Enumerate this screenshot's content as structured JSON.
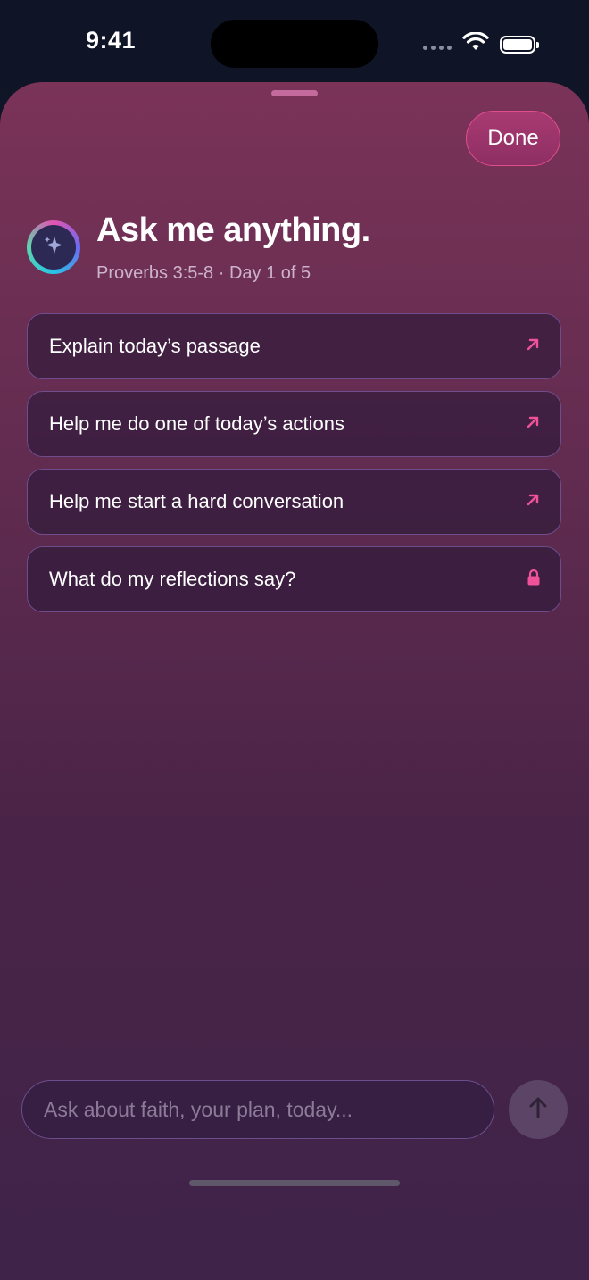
{
  "status_bar": {
    "time": "9:41"
  },
  "sheet": {
    "done_label": "Done",
    "title": "Ask me anything.",
    "subtitle": "Proverbs 3:5-8 · Day 1 of 5"
  },
  "suggestions": [
    {
      "label": "Explain today’s passage",
      "icon": "arrow-up-right-icon"
    },
    {
      "label": "Help me do one of today’s actions",
      "icon": "arrow-up-right-icon"
    },
    {
      "label": "Help me start a hard conversation",
      "icon": "arrow-up-right-icon"
    },
    {
      "label": "What do my reflections say?",
      "icon": "lock-icon"
    }
  ],
  "composer": {
    "placeholder": "Ask about faith, your plan, today...",
    "value": ""
  },
  "colors": {
    "accent": "#e24d8f",
    "sheet_top": "#7b3358",
    "sheet_bottom": "#3f2349"
  }
}
